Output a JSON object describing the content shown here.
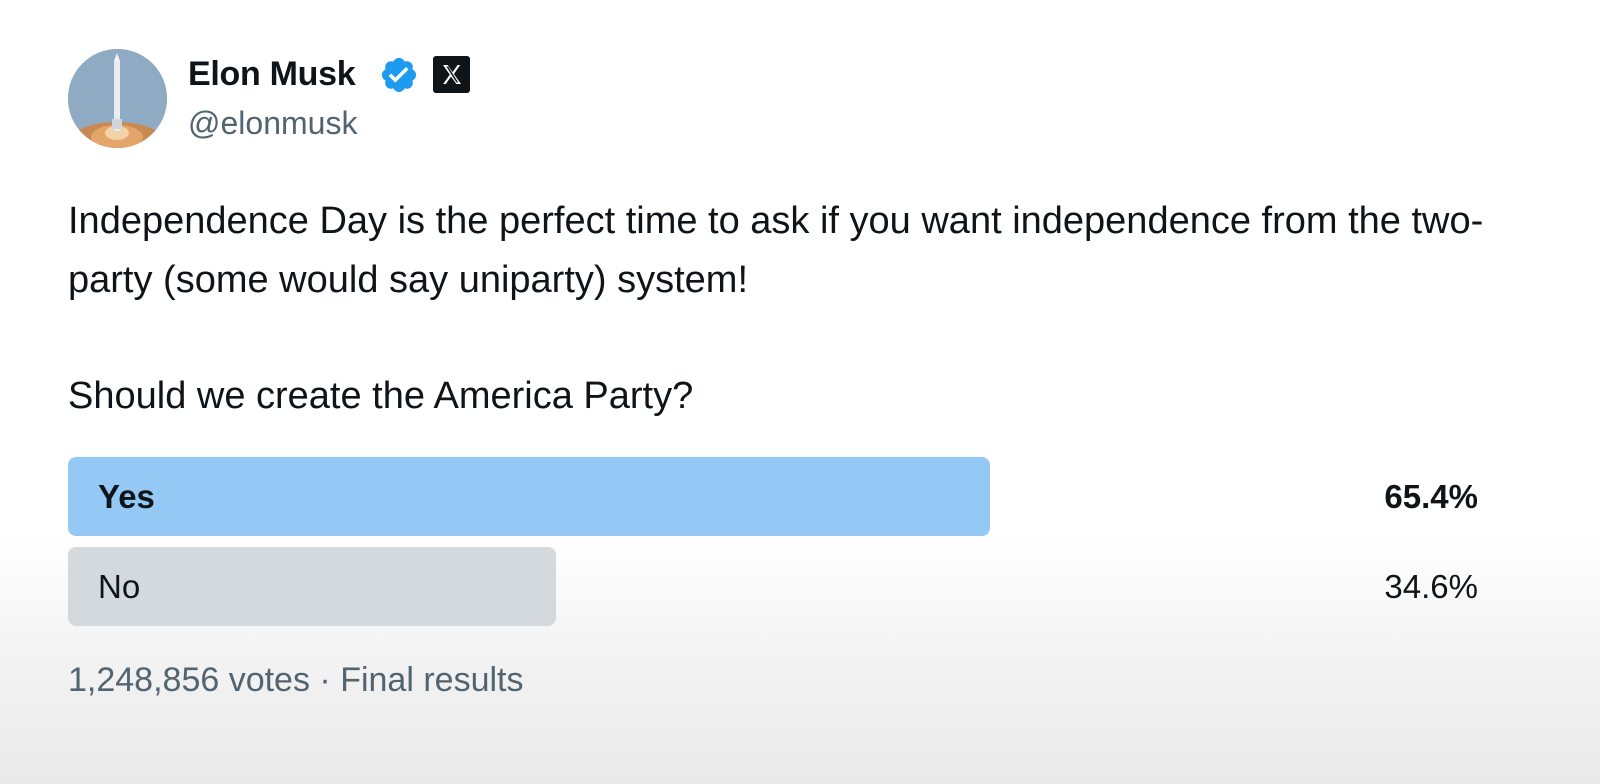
{
  "author": {
    "display_name": "Elon Musk",
    "handle": "@elonmusk",
    "verified_icon": "verified-badge-icon",
    "affiliation_icon": "x-logo-icon",
    "verified_color": "#1d9bf0"
  },
  "tweet": {
    "text": "Independence Day is the perfect time to ask if you want independence from the two-party (some would say uniparty) system!",
    "question": "Should we create the America Party?"
  },
  "poll": {
    "options": [
      {
        "label": "Yes",
        "percent": "65.4%",
        "share": 0.654,
        "winner": true,
        "bar_color": "#95c9f5"
      },
      {
        "label": "No",
        "percent": "34.6%",
        "share": 0.346,
        "winner": false,
        "bar_color": "#d4d9dd"
      }
    ],
    "votes": "1,248,856 votes",
    "separator": "·",
    "status": "Final results"
  }
}
